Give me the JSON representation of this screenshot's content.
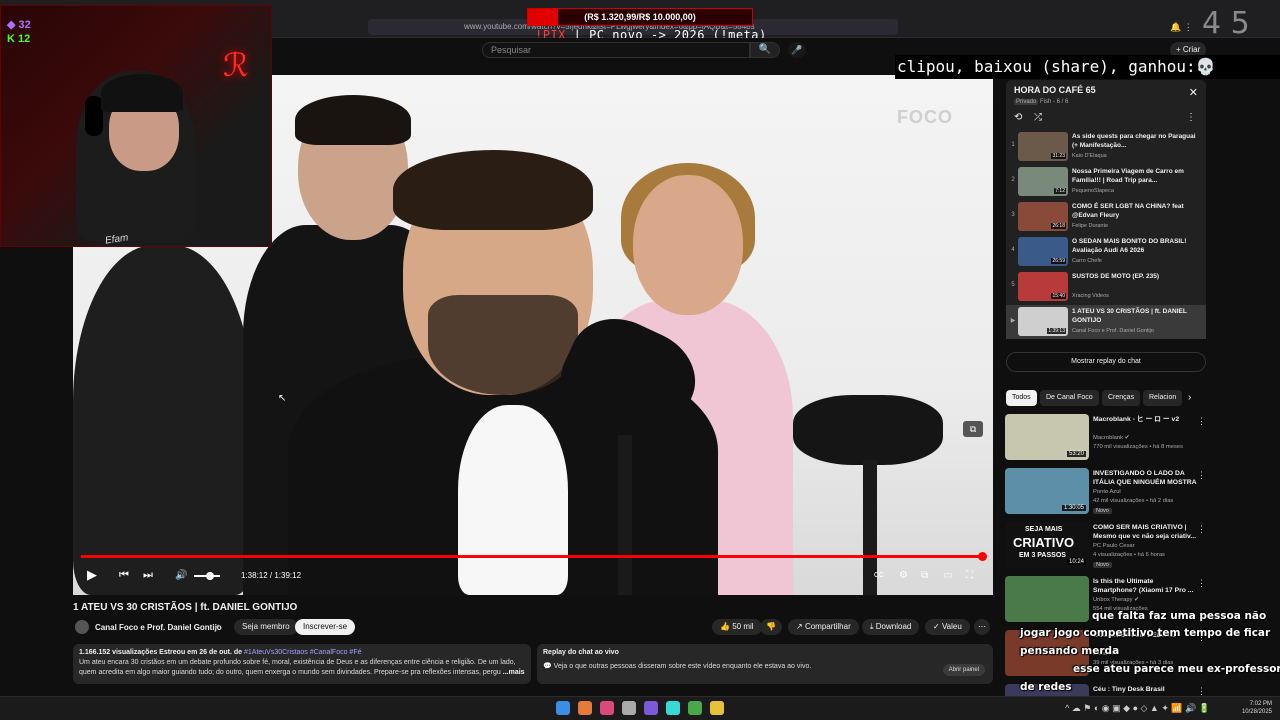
{
  "browser": {
    "url": "www.youtube.com/watch?v=5fjedhk&list=PLwgjwery&index=6&pp=iAQB&t=5848s",
    "back_icon": "arrow-left-icon",
    "forward_icon": "arrow-right-icon",
    "reload_icon": "reload-icon"
  },
  "stream_overlay": {
    "donation_goal": "(R$ 1.320,99/R$ 10.000,00)",
    "donation_progress": 0.132,
    "ticker_pix": "!PIX",
    "ticker_text": " | PC novo -> 2026 (!meta)",
    "viewer_count": "4 5",
    "clip_banner": "clipou, baixou (share), ganhou:💀",
    "counter_twitch": "32",
    "counter_kick": "12",
    "cursor_symbol": "↖"
  },
  "yt_header": {
    "search_placeholder": "Pesquisar",
    "search_symbol": "🔍",
    "mic_symbol": "🎤",
    "create_label": "+ Criar"
  },
  "video": {
    "watermark": "FOCO",
    "miniplayer_symbol": "⧉",
    "progress": 0.9978,
    "volume": 0.6,
    "time": "1:38:12 / 1:39:12",
    "play_symbol": "▶",
    "prev_symbol": "⏮",
    "next_symbol": "⏭",
    "volume_symbol": "🔊",
    "right_controls": [
      "CC",
      "⚙",
      "⧉",
      "▭",
      "⛶"
    ],
    "title": "1 ATEU VS 30 CRISTÃOS | ft. DANIEL GONTIJO"
  },
  "channel": {
    "name": "Canal Foco e Prof. Daniel Gontijo",
    "verified_symbol": "✔",
    "join_label": "Seja membro",
    "subscribe_label": "Inscrever-se"
  },
  "actions": {
    "like_symbol": "👍",
    "likes": "50 mil",
    "dislike_symbol": "👎",
    "share_symbol": "↗",
    "share_label": "Compartilhar",
    "download_symbol": "⤓",
    "download_label": "Download",
    "thanks_symbol": "✓",
    "thanks_label": "Valeu",
    "more_symbol": "⋯"
  },
  "description": {
    "stats": "1.166.152 visualizações  Estreou em 26 de out. de",
    "tags": "#1AteuVs30Cristaos #CanalFoco #Fé",
    "text": "Um ateu encara 30 cristãos em um debate profundo sobre fé, moral, existência de Deus e as diferenças entre ciência e religião. De um lado, quem acredita em algo maior guiando tudo; do outro, quem enxerga o mundo sem divindades. Prepare-se pra reflexões intensas, pergu",
    "more": "...mais"
  },
  "chat_replay_box": {
    "title": "Replay do chat ao vivo",
    "chat_symbol": "💬",
    "text": "Veja o que outras pessoas disseram sobre este vídeo enquanto ele estava ao vivo.",
    "button": "Abrir painel"
  },
  "playlist": {
    "title": "HORA DO CAFÉ 65",
    "close_symbol": "✕",
    "privacy": "Privado",
    "meta": "Fish - 6 / 6",
    "loop_symbol": "⟲",
    "shuffle_symbol": "⤮",
    "menu_symbol": "⋮",
    "items": [
      {
        "index": "1",
        "title": "As side quests para chegar no Paraguai (+ Manifestação...",
        "channel": "Kaio D'Elaqua",
        "duration": "31:23",
        "color": "#6b5a4a"
      },
      {
        "index": "2",
        "title": "Nossa Primeira Viagem de Carro em Família!!! | Road Trip para...",
        "channel": "PequenoSlapeca",
        "duration": "7:12",
        "color": "#7a8a7a"
      },
      {
        "index": "3",
        "title": "COMO É SER LGBT NA CHINA? feat @Edvan Fleury",
        "channel": "Felipe Durante",
        "duration": "26:18",
        "color": "#8a4a3a"
      },
      {
        "index": "4",
        "title": "O SEDAN MAIS BONITO DO BRASIL! Avaliação Audi A6 2026",
        "channel": "Carro Chefe",
        "duration": "26:59",
        "color": "#3a5a8a"
      },
      {
        "index": "5",
        "title": "SUSTOS DE MOTO (EP. 235)",
        "channel": "Xracing Videos",
        "duration": "15:40",
        "color": "#b83a3a"
      },
      {
        "index": "▶",
        "title": "1 ATEU VS 30 CRISTÃOS | ft. DANIEL GONTIJO",
        "channel": "Canal Foco e Prof. Daniel Gontijo",
        "duration": "1:39:13",
        "color": "#cfcfcf"
      }
    ]
  },
  "replay_button": "Mostrar replay do chat",
  "chips": [
    "Todos",
    "De Canal Foco",
    "Crenças",
    "Relacion"
  ],
  "chip_next_symbol": "›",
  "recommendations": [
    {
      "title": "Macroblank - ヒ ー ロ ー v2",
      "channel": "Macroblank ✔",
      "views": "770 mil visualizações • há 8 meses",
      "duration": "53:20",
      "badge": "",
      "thumb": "#c7c7b0"
    },
    {
      "title": "INVESTIGANDO O LADO DA ITÁLIA QUE NINGUÉM MOSTRA",
      "channel": "Ponto Azul",
      "views": "42 mil visualizações • há 2 dias",
      "duration": "1:30:05",
      "badge": "Novo",
      "thumb": "#5d8fa8"
    },
    {
      "title": "COMO SER MAIS CRIATIVO | Mesmo que vc não seja criativ...",
      "channel": "PC Paulo Cesar",
      "views": "4 visualizações • há 6 horas",
      "duration": "10:24",
      "badge": "Novo",
      "thumb": "#111111"
    },
    {
      "title": "Is this the Ultimate Smartphone? (Xiaomi 17 Pro ...",
      "channel": "Unbox Therapy ✔",
      "views": "554 mil visualizações",
      "duration": "",
      "badge": "",
      "thumb": "#4a7a4a"
    },
    {
      "title": "COMUNISTA EM DEBATE",
      "channel": "Durante",
      "views": "39 mil visualizações • há 3 dias",
      "duration": "",
      "badge": "",
      "thumb": "#7a3a2a"
    },
    {
      "title": "Céu : Tiny Desk Brasil",
      "channel": "",
      "views": "",
      "duration": "",
      "badge": "",
      "thumb": "#3a3a5a"
    }
  ],
  "rec_thumb_labels": {
    "criativo_top": "SEJA MAIS",
    "criativo_mid": "CRIATIVO",
    "criativo_bot": "EM 3 PASSOS"
  },
  "chat_overlay": [
    {
      "name": "",
      "text": "que falta faz uma pessoa não"
    },
    {
      "name": "",
      "text": "jogar jogo competitivo tem tempo de ficar"
    },
    {
      "name": "",
      "text": "pensando merda"
    },
    {
      "name": "",
      "text": "esse ateu parece meu ex-professor"
    },
    {
      "name": "",
      "text": "de redes"
    }
  ],
  "webcam": {
    "logo": "ℛ",
    "shirt_text": "Efam"
  },
  "taskbar": {
    "tray": "^ ☁ ⚑ ◐ ◉ ▣ ◆ ● ◇ ▲ ✦ 📶 🔊 🔋",
    "time": "7:02 PM",
    "date": "10/28/2025",
    "apps": [
      "#3a8ee6",
      "#e67a3a",
      "#d94a7a",
      "#aaaaaa",
      "#7a5ad9",
      "#3ad9d9",
      "#4aa84a",
      "#e6c23a"
    ]
  },
  "top_right": {
    "icons": "🔔 ⋮"
  }
}
